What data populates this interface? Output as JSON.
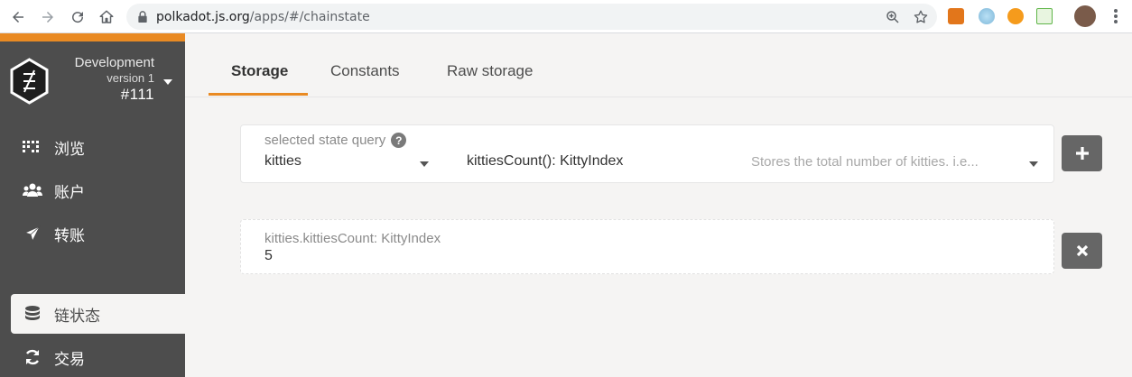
{
  "browser": {
    "url_host": "polkadot.js.org",
    "url_path": "/apps/#/chainstate"
  },
  "chain": {
    "name": "Development",
    "version": "version 1",
    "block": "#111"
  },
  "sidebar": {
    "items": [
      {
        "label": "浏览",
        "icon": "grid-dots-icon"
      },
      {
        "label": "账户",
        "icon": "users-icon"
      },
      {
        "label": "转账",
        "icon": "paper-plane-icon"
      },
      {
        "label": "链状态",
        "icon": "database-icon",
        "active": true
      },
      {
        "label": "交易",
        "icon": "sync-icon"
      }
    ]
  },
  "tabs": [
    {
      "label": "Storage",
      "active": true
    },
    {
      "label": "Constants"
    },
    {
      "label": "Raw storage"
    }
  ],
  "query": {
    "label": "selected state query",
    "module": "kitties",
    "method": "kittiesCount(): KittyIndex",
    "description": "Stores the total number of kitties. i.e..."
  },
  "result": {
    "label": "kitties.kittiesCount: KittyIndex",
    "value": "5"
  },
  "colors": {
    "accent": "#e98a23",
    "sidebar": "#4d4d4d",
    "button": "#666666"
  }
}
